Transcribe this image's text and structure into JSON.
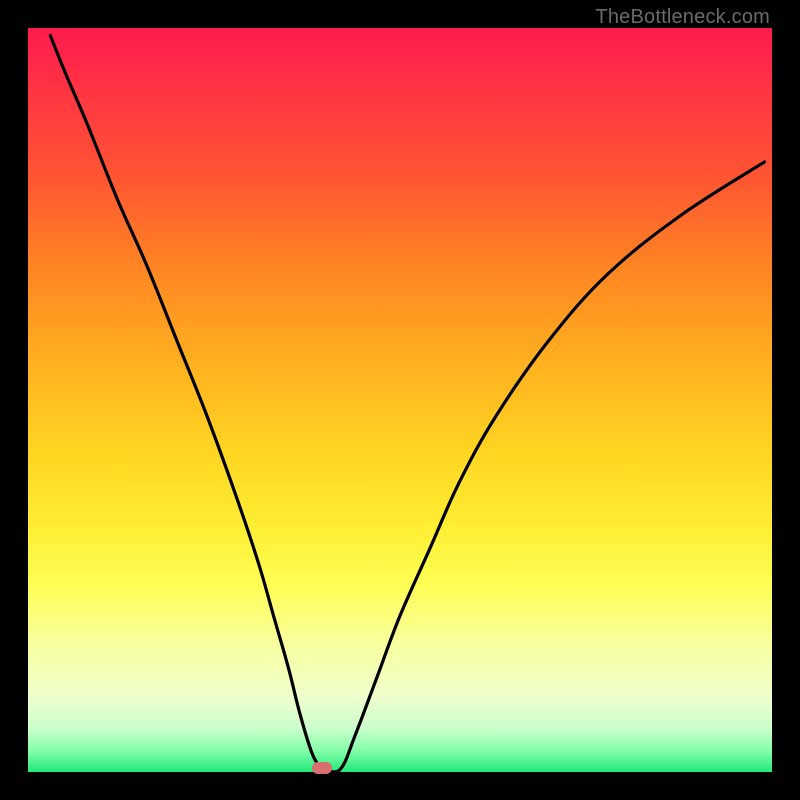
{
  "watermark": "TheBottleneck.com",
  "chart_data": {
    "type": "line",
    "title": "",
    "xlabel": "",
    "ylabel": "",
    "xlim": [
      0,
      100
    ],
    "ylim": [
      0,
      100
    ],
    "grid": false,
    "series": [
      {
        "name": "curve",
        "x": [
          3,
          5,
          8,
          12,
          16,
          20,
          24,
          28,
          31,
          33,
          35,
          36.5,
          38,
          39,
          39.8,
          42,
          44,
          47,
          50,
          54,
          58,
          63,
          70,
          78,
          88,
          99
        ],
        "values": [
          99,
          94,
          87,
          77,
          68,
          58,
          48,
          37,
          28,
          21,
          14,
          8,
          3,
          1,
          0.4,
          0.4,
          5,
          13,
          21,
          30,
          39,
          48,
          58,
          67,
          75,
          82
        ]
      }
    ],
    "marker": {
      "x": 39.5,
      "y": 0.6,
      "color": "#d86e6e"
    },
    "background_gradient": [
      "#ff1a4d",
      "#ffd522",
      "#feff55",
      "#22e97a"
    ]
  }
}
